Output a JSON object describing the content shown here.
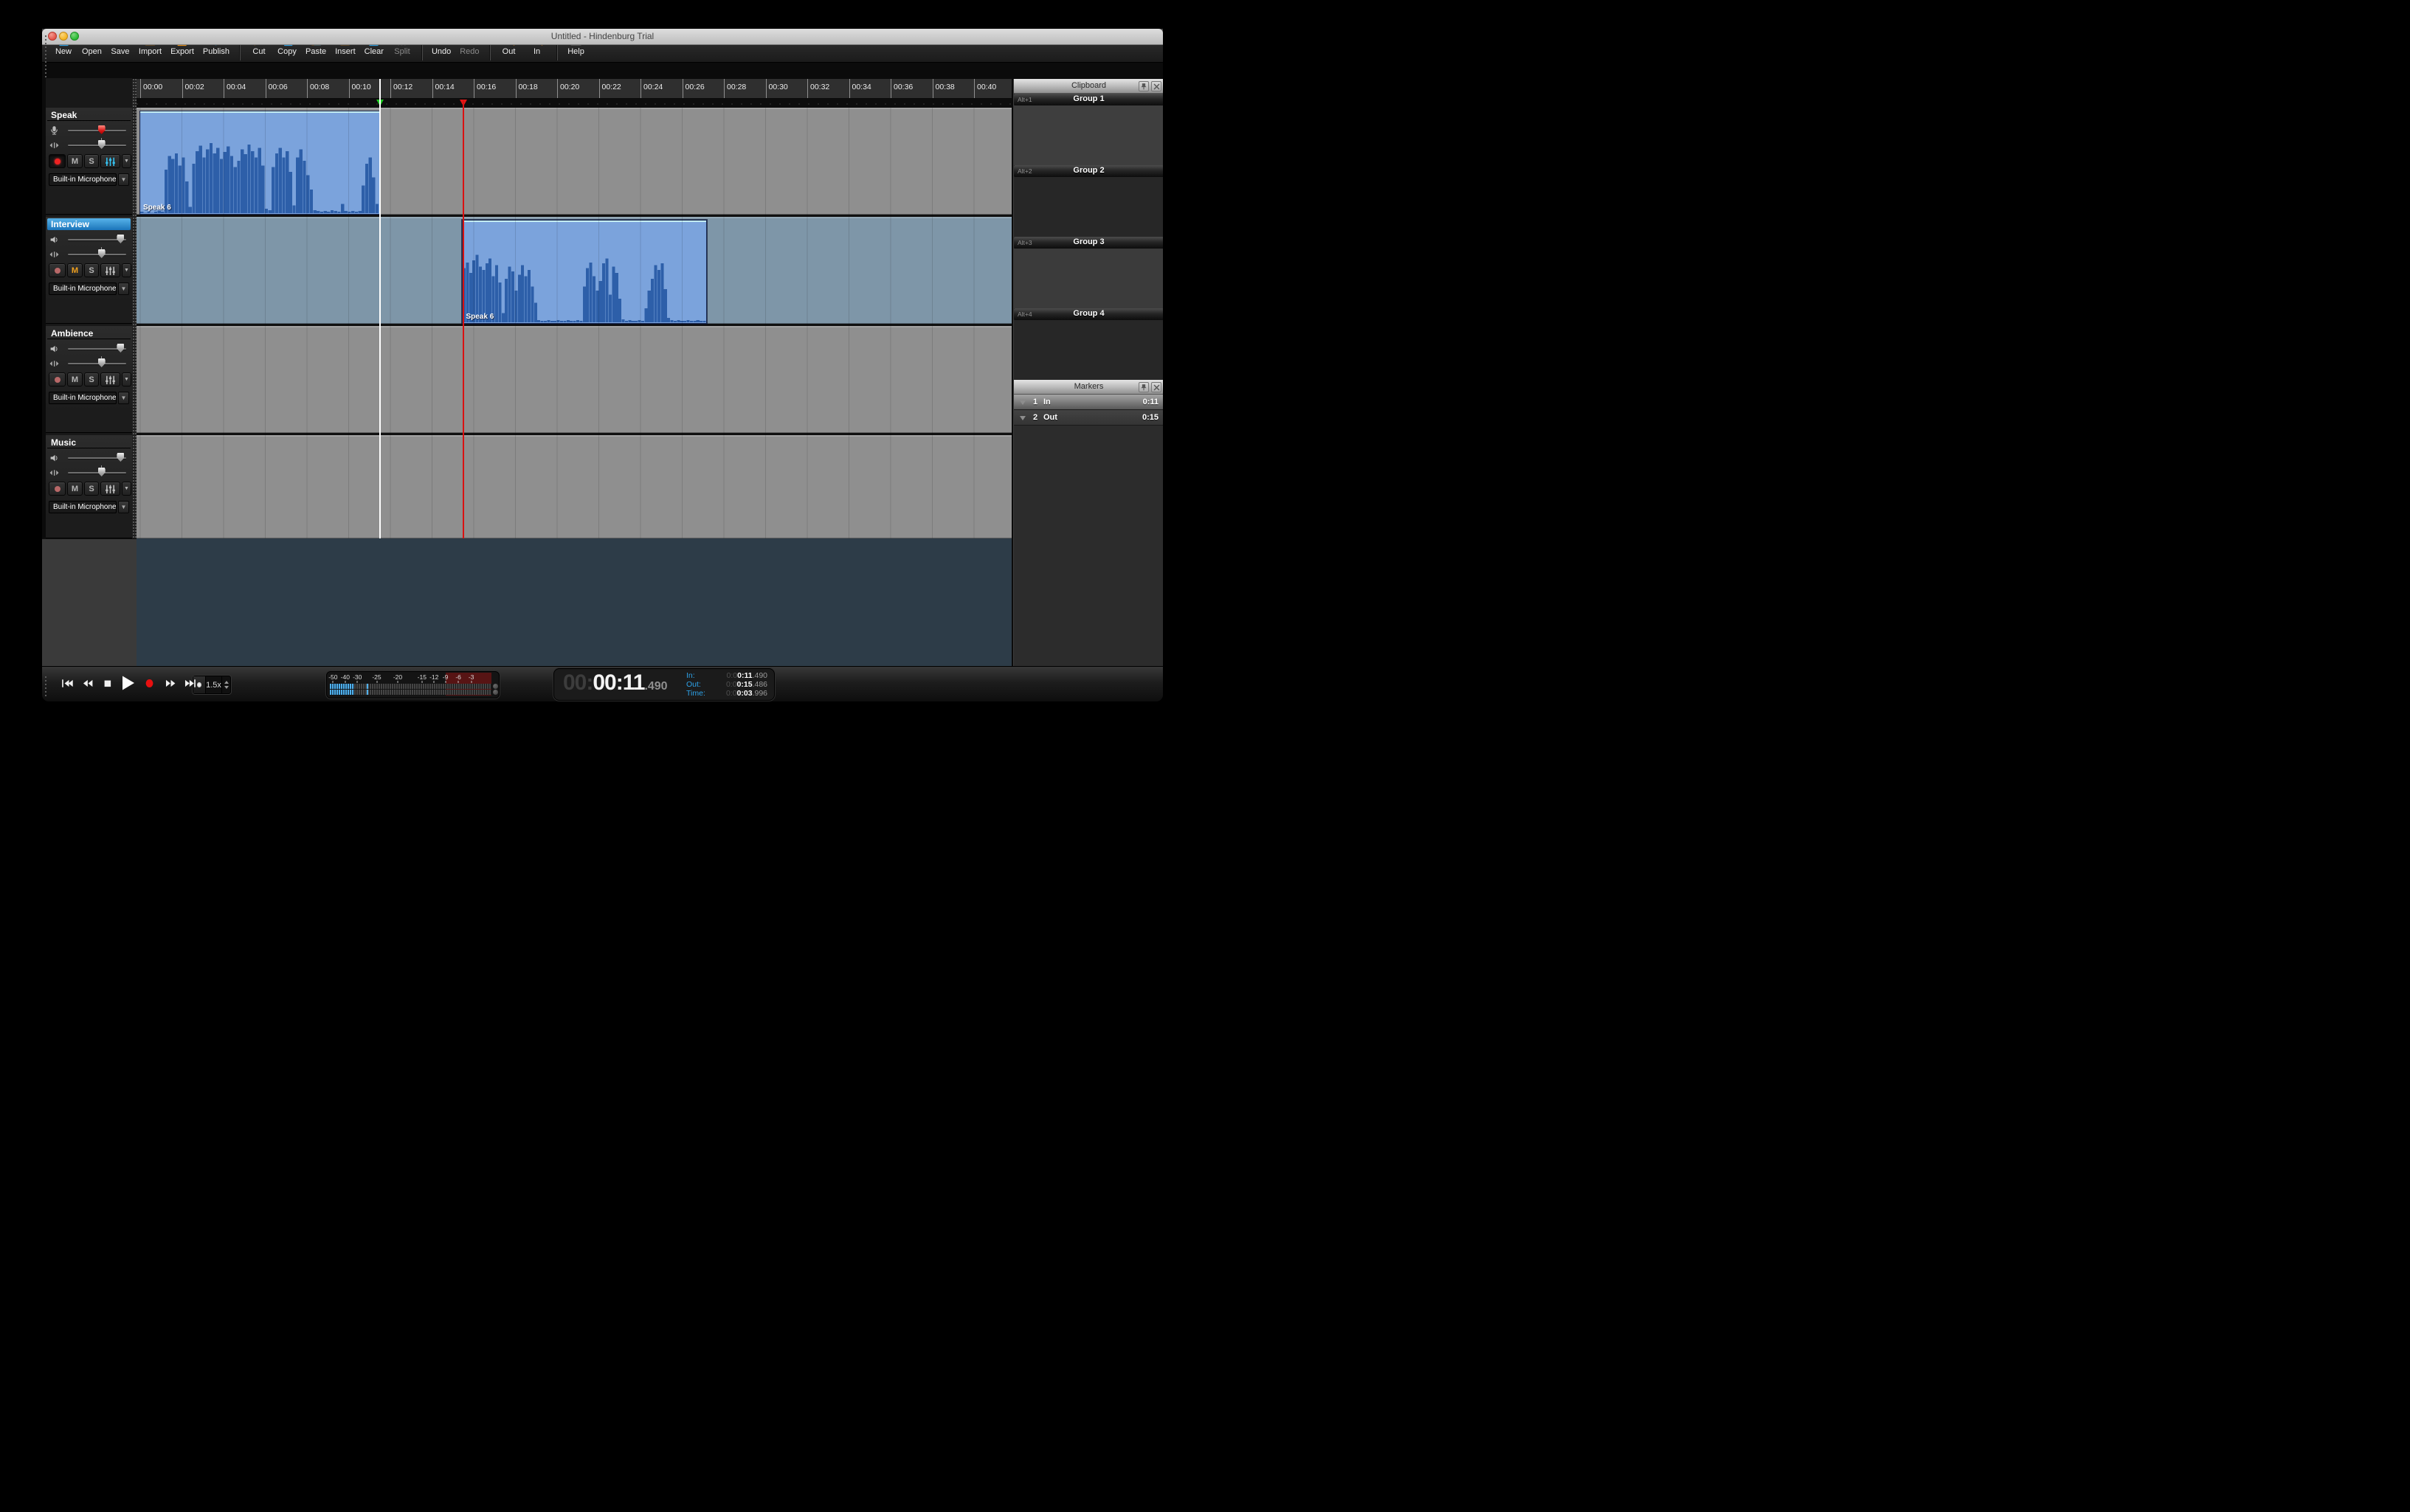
{
  "window": {
    "title": "Untitled - Hindenburg Trial"
  },
  "toolbar": {
    "items": [
      {
        "t": "b",
        "name": "new",
        "label": "New",
        "icon": "doc-new",
        "color": "blue"
      },
      {
        "t": "b",
        "name": "open",
        "label": "Open",
        "icon": "folder-open",
        "color": "orange"
      },
      {
        "t": "b",
        "name": "save",
        "label": "Save",
        "icon": "floppy-save",
        "color": "blue"
      },
      {
        "t": "b",
        "name": "import",
        "label": "Import",
        "icon": "import-wave",
        "color": "orange"
      },
      {
        "t": "b",
        "name": "export",
        "label": "Export",
        "icon": "export-arrow",
        "color": "orange"
      },
      {
        "t": "b",
        "name": "publish",
        "label": "Publish",
        "icon": "globe",
        "color": "blue"
      },
      {
        "t": "s"
      },
      {
        "t": "b",
        "name": "cut",
        "label": "Cut",
        "icon": "scissors",
        "color": "orange"
      },
      {
        "t": "b",
        "name": "copy",
        "label": "Copy",
        "icon": "copy-docs",
        "color": "blue"
      },
      {
        "t": "b",
        "name": "paste",
        "label": "Paste",
        "icon": "clipboard-paste",
        "color": "orange"
      },
      {
        "t": "b",
        "name": "insert",
        "label": "Insert",
        "icon": "clipboard-insert",
        "color": "orange"
      },
      {
        "t": "b",
        "name": "clear",
        "label": "Clear",
        "icon": "doc-clear",
        "color": "blue"
      },
      {
        "t": "b",
        "name": "split",
        "label": "Split",
        "icon": "split-frame",
        "color": "gray",
        "disabled": true
      },
      {
        "t": "s"
      },
      {
        "t": "b",
        "name": "undo",
        "label": "Undo",
        "icon": "undo-arrow",
        "color": "blue"
      },
      {
        "t": "b",
        "name": "redo",
        "label": "Redo",
        "icon": "redo-arrow",
        "color": "gray",
        "disabled": true
      },
      {
        "t": "s"
      },
      {
        "t": "b",
        "name": "zoom-out",
        "label": "Out",
        "icon": "magnifier-minus",
        "color": "orange"
      },
      {
        "t": "b",
        "name": "zoom-in",
        "label": "In",
        "icon": "magnifier-plus",
        "color": "orange"
      },
      {
        "t": "s"
      },
      {
        "t": "b",
        "name": "help",
        "label": "Help",
        "icon": "help-box",
        "color": "orange"
      }
    ]
  },
  "ruler": {
    "labels": [
      "00:00",
      "00:02",
      "00:04",
      "00:06",
      "00:08",
      "00:10",
      "00:12",
      "00:14",
      "00:16",
      "00:18",
      "00:20",
      "00:22",
      "00:24",
      "00:26",
      "00:28",
      "00:30",
      "00:32",
      "00:34",
      "00:36",
      "00:38",
      "00:40"
    ],
    "seconds_per_label": 2
  },
  "timeline": {
    "flags": [
      {
        "name": "in-marker",
        "time": 11.49,
        "flag_color": "#1ecb22",
        "line_color": "#ffffff"
      },
      {
        "name": "out-marker",
        "time": 15.486,
        "flag_color": "#e51717",
        "line_color": "#d91111"
      }
    ]
  },
  "tracks": [
    {
      "name": "Speak",
      "selected": false,
      "input_icon": "microphone",
      "slider1_value": 49,
      "slider1_handle": "red",
      "pan_value": 49,
      "record_active": true,
      "mute_active": false,
      "solo_active": false,
      "mixer_accent": true,
      "mute_label": "M",
      "solo_label": "S",
      "device": "Built-in Microphone",
      "lane_color": "#8f8f8f"
    },
    {
      "name": "Interview",
      "selected": true,
      "input_icon": "speaker",
      "slider1_value": 80,
      "slider1_handle": "gray",
      "pan_value": 49,
      "record_active": false,
      "mute_active": true,
      "solo_active": false,
      "mixer_accent": false,
      "mute_label": "M",
      "solo_label": "S",
      "device": "Built-in Microphone",
      "lane_color": "#7e96a8"
    },
    {
      "name": "Ambience",
      "selected": false,
      "input_icon": "speaker",
      "slider1_value": 80,
      "slider1_handle": "gray",
      "pan_value": 49,
      "record_active": false,
      "mute_active": false,
      "solo_active": false,
      "mixer_accent": false,
      "mute_label": "M",
      "solo_label": "S",
      "device": "Built-in Microphone",
      "lane_color": "#8f8f8f"
    },
    {
      "name": "Music",
      "selected": false,
      "input_icon": "speaker",
      "slider1_value": 80,
      "slider1_handle": "gray",
      "pan_value": 49,
      "record_active": false,
      "mute_active": false,
      "solo_active": false,
      "mixer_accent": false,
      "mute_label": "M",
      "solo_label": "S",
      "device": "Built-in Microphone",
      "lane_color": "#8f8f8f"
    }
  ],
  "clips": [
    {
      "track": 0,
      "label": "Speak 6",
      "start": 0,
      "end": 11.49,
      "selected": false,
      "waveform": [
        2,
        1,
        2,
        1,
        2,
        3,
        2,
        55,
        72,
        68,
        75,
        60,
        70,
        40,
        8,
        62,
        78,
        85,
        70,
        80,
        88,
        75,
        82,
        68,
        77,
        84,
        72,
        58,
        66,
        80,
        74,
        86,
        78,
        70,
        82,
        60,
        6,
        4,
        58,
        75,
        82,
        70,
        78,
        52,
        10,
        70,
        80,
        66,
        48,
        30,
        4,
        3,
        2,
        3,
        2,
        4,
        3,
        2,
        12,
        3,
        2,
        3,
        2,
        3,
        35,
        62,
        70,
        45,
        12
      ]
    },
    {
      "track": 1,
      "label": "Speak 6",
      "start": 15.486,
      "end": 27.2,
      "selected": true,
      "waveform": [
        68,
        75,
        62,
        78,
        85,
        70,
        66,
        74,
        80,
        58,
        72,
        50,
        12,
        55,
        70,
        64,
        40,
        60,
        72,
        58,
        66,
        45,
        25,
        3,
        2,
        2,
        3,
        2,
        2,
        3,
        2,
        2,
        3,
        2,
        2,
        3,
        2,
        45,
        68,
        75,
        58,
        40,
        52,
        74,
        80,
        35,
        70,
        62,
        30,
        4,
        2,
        3,
        2,
        2,
        3,
        2,
        18,
        40,
        55,
        72,
        66,
        74,
        42,
        6,
        3,
        2,
        3,
        2,
        2,
        3,
        2,
        2,
        3,
        2,
        2
      ]
    }
  ],
  "clipboard": {
    "title": "Clipboard",
    "groups": [
      {
        "shortcut": "Alt+1",
        "label": "Group 1",
        "body_color": "#3e3e3e"
      },
      {
        "shortcut": "Alt+2",
        "label": "Group 2",
        "body_color": "#272727"
      },
      {
        "shortcut": "Alt+3",
        "label": "Group 3",
        "body_color": "#3b3b3b"
      },
      {
        "shortcut": "Alt+4",
        "label": "Group 4",
        "body_color": "#272727"
      }
    ]
  },
  "markers": {
    "title": "Markers",
    "rows": [
      {
        "number": "1",
        "label": "In",
        "time": "0:11",
        "selected": true
      },
      {
        "number": "2",
        "label": "Out",
        "time": "0:15",
        "selected": false
      }
    ]
  },
  "transport": {
    "buttons": [
      {
        "name": "skip-to-start",
        "icon": "skip-start"
      },
      {
        "name": "rewind",
        "icon": "rew"
      },
      {
        "name": "stop",
        "icon": "stop"
      },
      {
        "name": "play",
        "icon": "play"
      },
      {
        "name": "record",
        "icon": "record"
      },
      {
        "name": "fast-forward",
        "icon": "ffwd"
      },
      {
        "name": "skip-to-end",
        "icon": "skip-end"
      }
    ],
    "speed": "1.5x"
  },
  "meter": {
    "scale": [
      {
        "label": "-50",
        "pos": 2
      },
      {
        "label": "-40",
        "pos": 9.5
      },
      {
        "label": "-30",
        "pos": 17
      },
      {
        "label": "-25",
        "pos": 29
      },
      {
        "label": "-20",
        "pos": 42
      },
      {
        "label": "-15",
        "pos": 57
      },
      {
        "label": "-12",
        "pos": 64.5
      },
      {
        "label": "-9",
        "pos": 71.5
      },
      {
        "label": "-6",
        "pos": 79.5
      },
      {
        "label": "-3",
        "pos": 87.5
      }
    ],
    "red_zone_start_pct": 71.5,
    "lit_pct": 15,
    "isolated_pct": 23
  },
  "time_display": {
    "hours_dim": "00:",
    "main": "00:11",
    "fraction": ".490",
    "fields": [
      {
        "label": "In:",
        "dim": "0:0",
        "main": "0:11",
        "frac": ".490"
      },
      {
        "label": "Out:",
        "dim": "0:0",
        "main": "0:15",
        "frac": ".486"
      },
      {
        "label": "Time:",
        "dim": "0:0",
        "main": "0:03",
        "frac": ".996"
      }
    ]
  },
  "colors": {
    "accent_blue": "#2f9fe0",
    "accent_orange": "#e8911c",
    "disabled_gray": "#9a9a9a",
    "clip_bg": "#7ba3dc",
    "clip_wave": "#2d5fa9",
    "lane_gray": "#8f8f8f",
    "lane_selected": "#7e96a8",
    "teal_bg": "#2d3c48",
    "record_red": "#ee2222",
    "mute_orange": "#f0a01e",
    "mixer_blue": "#35c3f2"
  }
}
